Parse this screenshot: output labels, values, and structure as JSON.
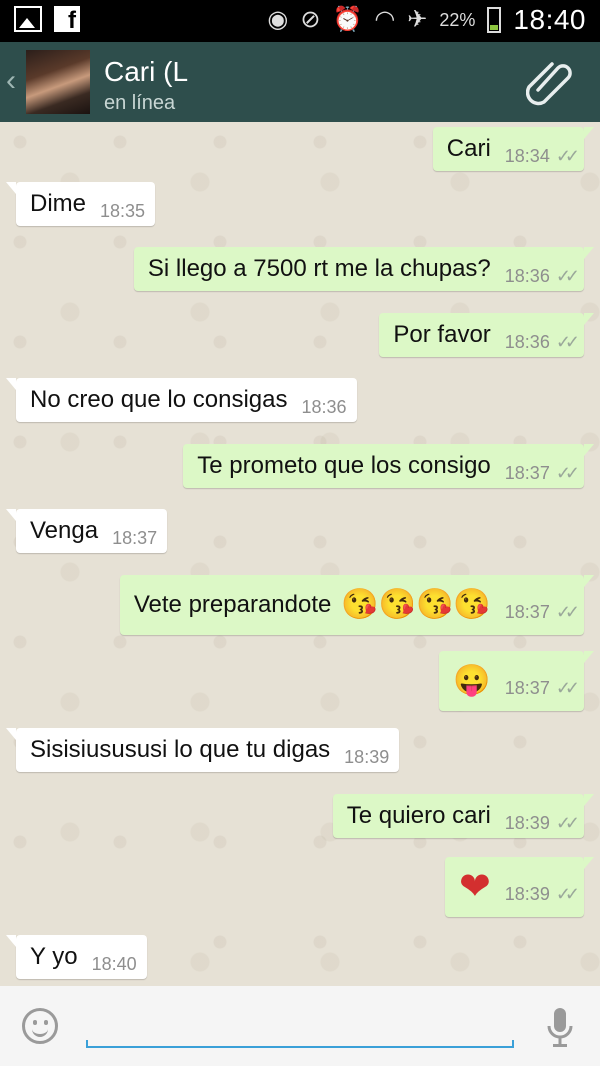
{
  "status_bar": {
    "battery_percent": "22%",
    "clock": "18:40",
    "left_icons": [
      "image-notification-icon",
      "facebook-notification-icon"
    ],
    "right_icons": [
      "eye-icon",
      "muted-icon",
      "alarm-icon",
      "wifi-icon",
      "airplane-mode-icon",
      "battery-icon"
    ]
  },
  "header": {
    "contact_name": "Cari (L",
    "status": "en línea",
    "back_icon": "chevron-left-icon",
    "attach_icon": "paperclip-icon"
  },
  "messages": [
    {
      "dir": "out",
      "text": "Cari",
      "time": "18:34",
      "ticks": "✓✓"
    },
    {
      "dir": "in",
      "text": "Dime",
      "time": "18:35"
    },
    {
      "dir": "out",
      "text": "Si llego a 7500 rt me la chupas?",
      "time": "18:36",
      "ticks": "✓✓"
    },
    {
      "dir": "out",
      "text": "Por favor",
      "time": "18:36",
      "ticks": "✓✓"
    },
    {
      "dir": "in",
      "text": "No creo que lo consigas",
      "time": "18:36"
    },
    {
      "dir": "out",
      "text": "Te prometo que los consigo",
      "time": "18:37",
      "ticks": "✓✓"
    },
    {
      "dir": "in",
      "text": "Venga",
      "time": "18:37"
    },
    {
      "dir": "out",
      "text": "Vete preparandote",
      "emoji": "😘😘😘😘",
      "time": "18:37",
      "ticks": "✓✓"
    },
    {
      "dir": "out",
      "emoji": "😛",
      "time": "18:37",
      "ticks": "✓✓"
    },
    {
      "dir": "in",
      "text": "Sisisiusususi lo que tu digas",
      "time": "18:39"
    },
    {
      "dir": "out",
      "text": "Te quiero cari",
      "time": "18:39",
      "ticks": "✓✓"
    },
    {
      "dir": "out",
      "emoji": "❤",
      "time": "18:39",
      "ticks": "✓✓"
    },
    {
      "dir": "in",
      "text": "Y yo",
      "time": "18:40"
    }
  ],
  "input_bar": {
    "emoji_icon": "smiley-icon",
    "mic_icon": "microphone-icon",
    "text_value": ""
  },
  "colors": {
    "header_bg": "#2e4e4c",
    "outgoing_bubble": "#dcf8c6",
    "incoming_bubble": "#ffffff",
    "chat_bg": "#e6e1d5",
    "input_underline": "#3aa0d8"
  }
}
